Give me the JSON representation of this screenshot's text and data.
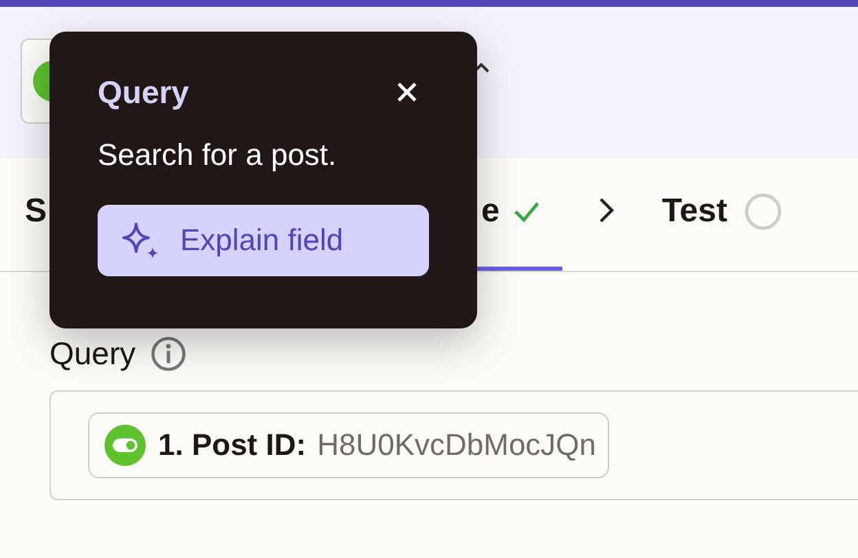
{
  "tabs": [
    {
      "label": "S",
      "selected": false,
      "kind": "plain"
    },
    {
      "label": "e",
      "selected": true,
      "kind": "done"
    },
    {
      "label": "Test",
      "selected": false,
      "kind": "pending"
    }
  ],
  "field": {
    "label": "Query",
    "chip": {
      "step": "1. Post ID:",
      "value": "H8U0KvcDbMocJQn"
    }
  },
  "popover": {
    "title": "Query",
    "text": "Search for a post.",
    "button": "Explain field"
  }
}
